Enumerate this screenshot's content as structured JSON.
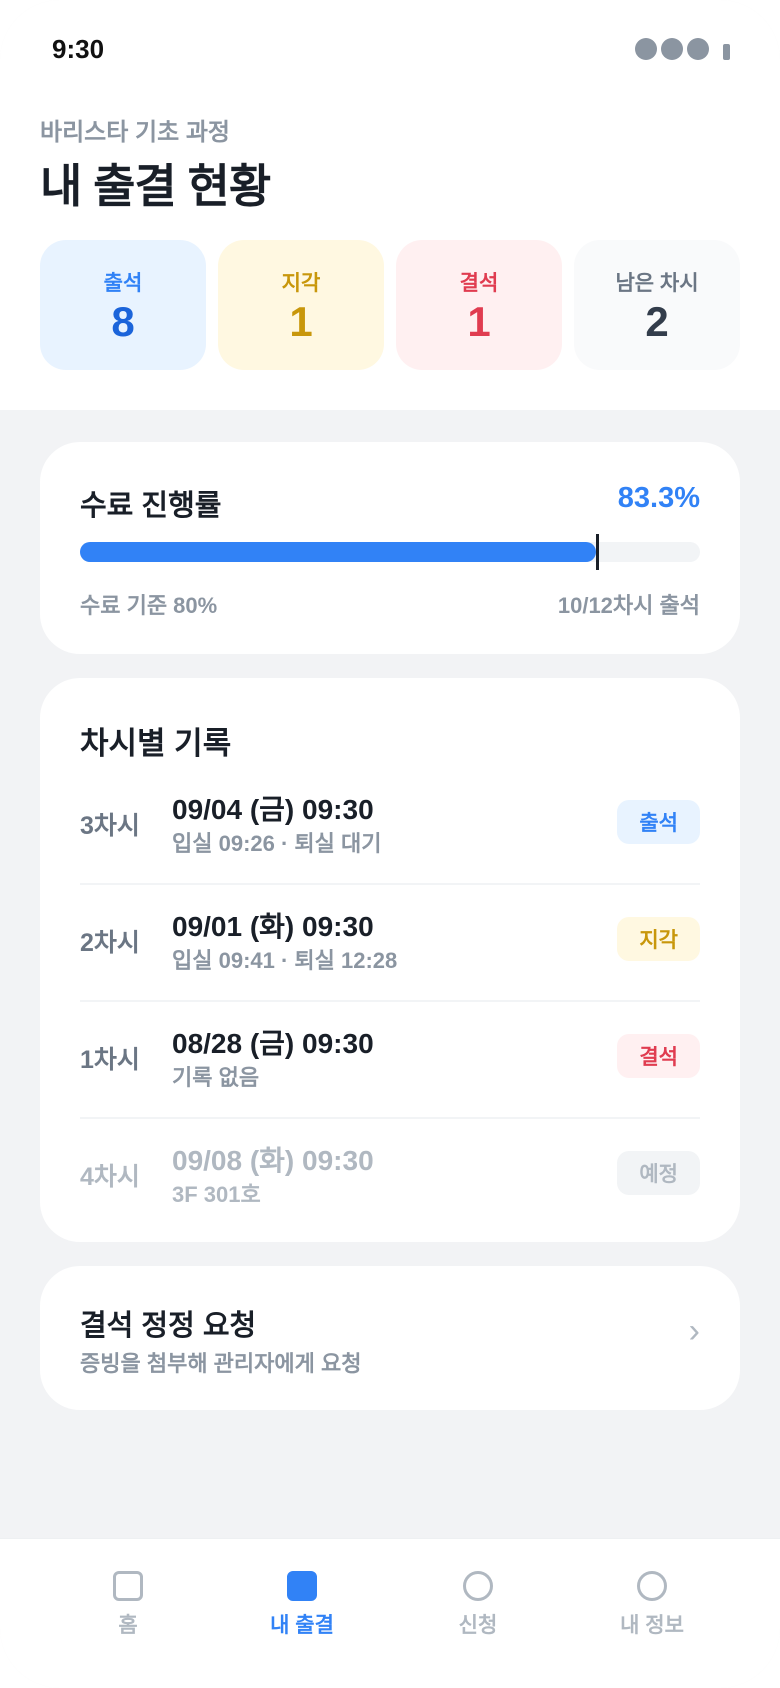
{
  "status_bar": {
    "time": "9:30"
  },
  "header": {
    "course": "바리스타 기초 과정",
    "title": "내 출결 현황"
  },
  "stats": [
    {
      "label": "출석",
      "value": "8",
      "label_color": "#3182f6",
      "value_color": "#1b64da",
      "bg": "#e8f3ff"
    },
    {
      "label": "지각",
      "value": "1",
      "label_color": "#c8970b",
      "value_color": "#c8970b",
      "bg": "#fff8e1"
    },
    {
      "label": "결석",
      "value": "1",
      "label_color": "#e03c50",
      "value_color": "#e03c50",
      "bg": "#fff0f1"
    },
    {
      "label": "남은 차시",
      "value": "2",
      "label_color": "#6b7684",
      "value_color": "#333d4b",
      "bg": "#f9fafb"
    }
  ],
  "progress": {
    "title": "수료 진행률",
    "percent_label": "83.3%",
    "value": 0.833,
    "threshold": 0.8,
    "threshold_label": "수료 기준 80%",
    "count_label": "10/12차시 출석",
    "fill_color": "#3182f6"
  },
  "records": {
    "title": "차시별 기록",
    "rows": [
      {
        "session": "3차시",
        "date": "09/04 (금) 09:30",
        "meta": "입실 09:26 · 퇴실 대기",
        "status": "출석",
        "badge_bg": "#e8f3ff",
        "badge_color": "#3182f6",
        "future": false
      },
      {
        "session": "2차시",
        "date": "09/01 (화) 09:30",
        "meta": "입실 09:41 · 퇴실 12:28",
        "status": "지각",
        "badge_bg": "#fff8e1",
        "badge_color": "#c8970b",
        "future": false
      },
      {
        "session": "1차시",
        "date": "08/28 (금) 09:30",
        "meta": "기록 없음",
        "status": "결석",
        "badge_bg": "#fff0f1",
        "badge_color": "#e03c50",
        "future": false
      },
      {
        "session": "4차시",
        "date": "09/08 (화) 09:30",
        "meta": "3F 301호",
        "status": "예정",
        "badge_bg": "#f2f4f6",
        "badge_color": "#b0b8c1",
        "future": true
      }
    ]
  },
  "request": {
    "title": "결석 정정 요청",
    "subtitle": "증빙을 첨부해 관리자에게 요청",
    "arrow": "›"
  },
  "nav": {
    "active_color": "#3182f6",
    "items": [
      {
        "label": "홈",
        "icon": "home-icon",
        "shape": "square",
        "active": false
      },
      {
        "label": "내 출결",
        "icon": "attendance-icon",
        "shape": "square",
        "active": true
      },
      {
        "label": "신청",
        "icon": "apply-icon",
        "shape": "circle",
        "active": false
      },
      {
        "label": "내 정보",
        "icon": "profile-icon",
        "shape": "circle",
        "active": false
      }
    ]
  }
}
